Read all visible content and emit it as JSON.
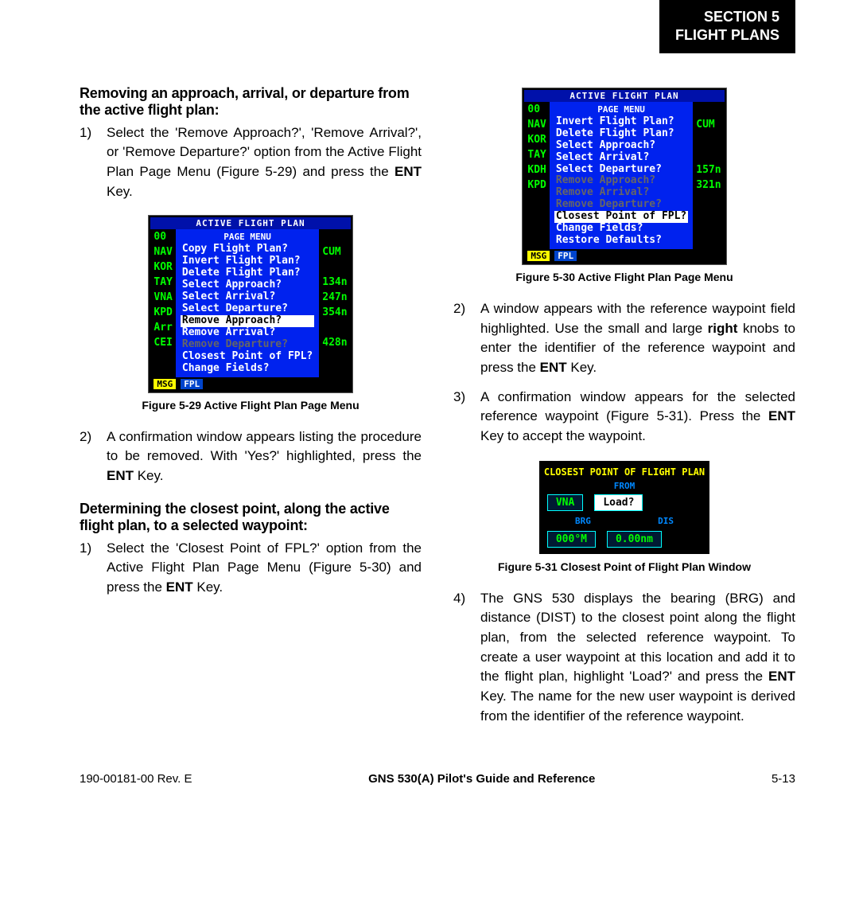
{
  "header": {
    "line1": "SECTION 5",
    "line2": "FLIGHT PLANS"
  },
  "subheads": {
    "h1": "Removing an approach, arrival, or departure from the active flight plan:",
    "h2": "Determining the closest point, along the active flight plan, to a selected waypoint:"
  },
  "steps_a": [
    {
      "n": "1)",
      "t": "Select the 'Remove Approach?', 'Remove Arrival?', or 'Remove Departure?' option from the Active Flight Plan Page Menu (Figure 5-29) and press the <b>ENT</b> Key."
    },
    {
      "n": "2)",
      "t": "A confirmation window appears listing the procedure to be removed.  With 'Yes?' highlighted, press the <b>ENT</b> Key."
    }
  ],
  "steps_b": [
    {
      "n": "1)",
      "t": "Select the 'Closest Point of FPL?' option from the Active Flight Plan Page Menu (Figure 5-30) and press the <b>ENT</b> Key."
    }
  ],
  "steps_c": [
    {
      "n": "2)",
      "t": "A window appears with the reference waypoint field highlighted.  Use the small  and large <b>right</b> knobs to enter the identifier of the reference waypoint and press the <b>ENT</b> Key."
    },
    {
      "n": "3)",
      "t": "A confirmation window appears for the selected reference waypoint (Figure 5-31). Press the <b>ENT</b> Key to accept the waypoint."
    },
    {
      "n": "4)",
      "t": "The GNS 530 displays the bearing (BRG) and distance (DIST) to the closest point along the flight plan, from the selected reference waypoint.  To create a user waypoint at this location and add it to the flight plan, highlight 'Load?' and press the <b>ENT</b> Key.  The name for the new user waypoint is derived from the identifier of the reference waypoint."
    }
  ],
  "fig29": {
    "caption": "Figure 5-29  Active Flight Plan Page Menu",
    "screen_title": "ACTIVE FLIGHT PLAN",
    "menu_title": "PAGE MENU",
    "side_wp": [
      "00",
      "NAV",
      "KOR",
      "TAY",
      "VNA",
      "KPD",
      "Arr",
      "CEI"
    ],
    "side_val": [
      "",
      "CUM",
      "",
      "134n",
      "247n",
      "354n",
      "",
      "428n"
    ],
    "items": [
      {
        "t": "Copy Flight Plan?",
        "s": false,
        "d": false
      },
      {
        "t": "Invert Flight Plan?",
        "s": false,
        "d": false
      },
      {
        "t": "Delete Flight Plan?",
        "s": false,
        "d": false
      },
      {
        "t": "Select Approach?",
        "s": false,
        "d": false
      },
      {
        "t": "Select Arrival?",
        "s": false,
        "d": false
      },
      {
        "t": "Select Departure?",
        "s": false,
        "d": false
      },
      {
        "t": "Remove Approach?",
        "s": true,
        "d": false
      },
      {
        "t": "Remove Arrival?",
        "s": false,
        "d": false
      },
      {
        "t": "Remove Departure?",
        "s": false,
        "d": true
      },
      {
        "t": "Closest Point of FPL?",
        "s": false,
        "d": false
      },
      {
        "t": "Change Fields?",
        "s": false,
        "d": false
      }
    ],
    "bar": [
      "MSG",
      "FPL"
    ]
  },
  "fig30": {
    "caption": "Figure 5-30  Active Flight Plan Page Menu",
    "screen_title": "ACTIVE FLIGHT PLAN",
    "menu_title": "PAGE MENU",
    "side_wp": [
      "00",
      "NAV",
      "KOR",
      "TAY",
      "KDH",
      "KPD"
    ],
    "side_val": [
      "",
      "CUM",
      "",
      "",
      "157n",
      "321n"
    ],
    "items": [
      {
        "t": "Invert Flight Plan?",
        "s": false,
        "d": false
      },
      {
        "t": "Delete Flight Plan?",
        "s": false,
        "d": false
      },
      {
        "t": "Select Approach?",
        "s": false,
        "d": false
      },
      {
        "t": "Select Arrival?",
        "s": false,
        "d": false
      },
      {
        "t": "Select Departure?",
        "s": false,
        "d": false
      },
      {
        "t": "Remove Approach?",
        "s": false,
        "d": true
      },
      {
        "t": "Remove Arrival?",
        "s": false,
        "d": true
      },
      {
        "t": "Remove Departure?",
        "s": false,
        "d": true
      },
      {
        "t": "Closest Point of FPL?",
        "s": true,
        "d": false
      },
      {
        "t": "Change Fields?",
        "s": false,
        "d": false
      },
      {
        "t": "Restore Defaults?",
        "s": false,
        "d": false
      }
    ],
    "bar": [
      "MSG",
      "FPL"
    ]
  },
  "fig31": {
    "caption": "Figure 5-31  Closest Point of Flight Plan Window",
    "title": "CLOSEST POINT OF FLIGHT PLAN",
    "from_label": "FROM",
    "from_val": "VNA",
    "load": "Load?",
    "brg_label": "BRG",
    "dis_label": "DIS",
    "brg": "000°M",
    "dis": "0.00nm"
  },
  "footer": {
    "left": "190-00181-00  Rev. E",
    "mid": "GNS 530(A) Pilot's Guide and Reference",
    "right": "5-13"
  }
}
